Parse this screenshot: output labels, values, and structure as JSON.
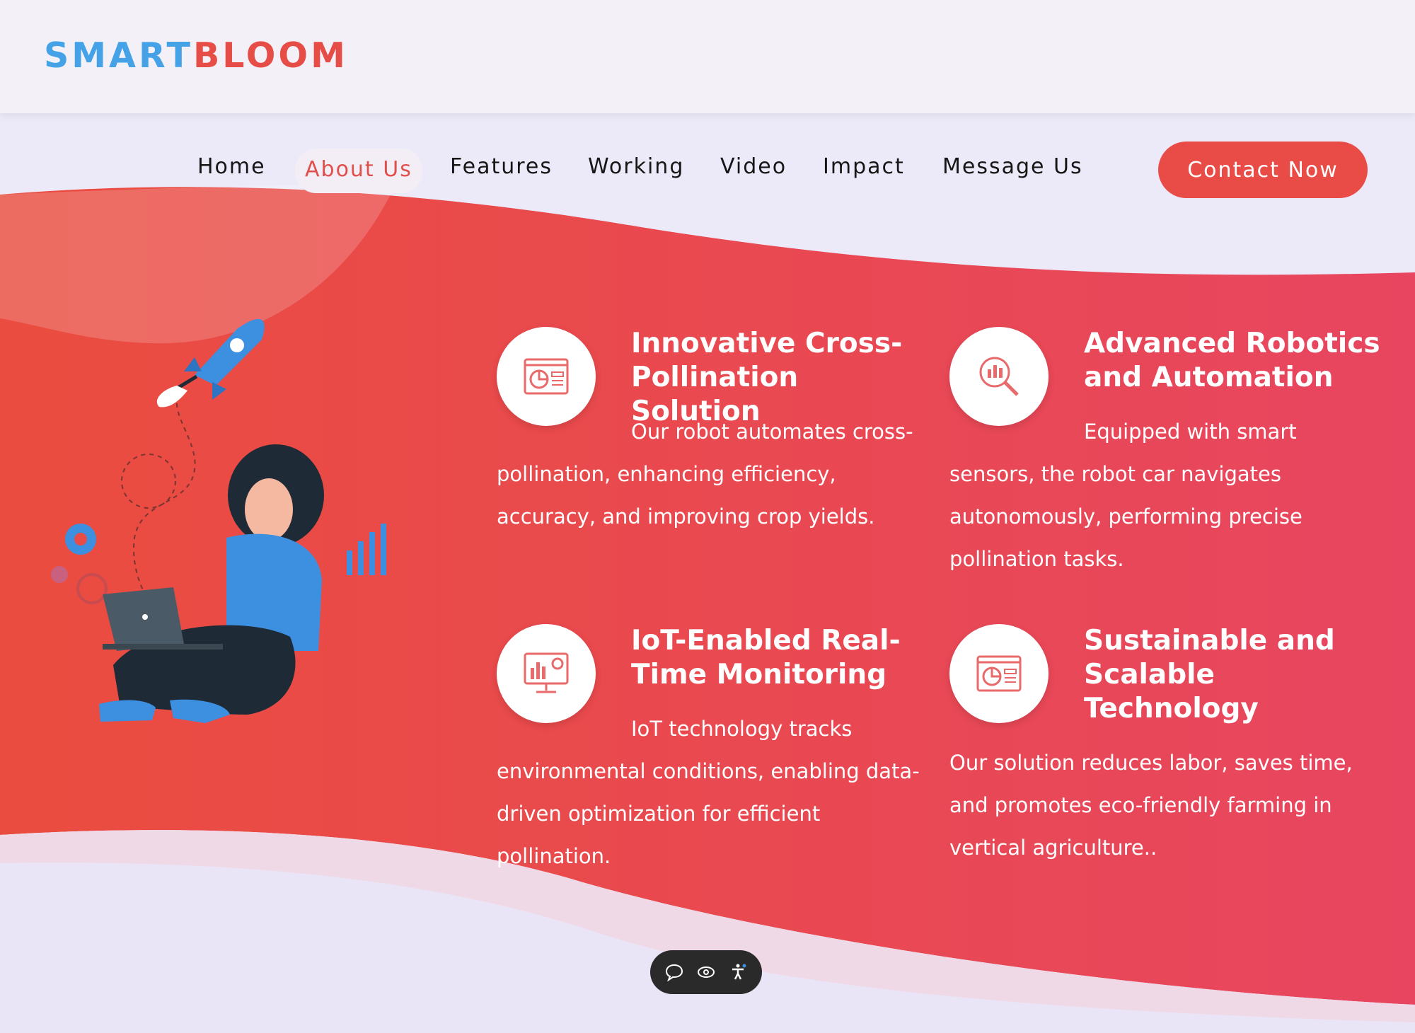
{
  "brand": {
    "part1": "SMART",
    "part2": "BLOOM"
  },
  "nav": {
    "items": [
      {
        "label": "Home"
      },
      {
        "label": "About Us"
      },
      {
        "label": "Features"
      },
      {
        "label": "Working"
      },
      {
        "label": "Video"
      },
      {
        "label": "Impact"
      },
      {
        "label": "Message Us"
      }
    ],
    "active": "About Us",
    "contact_label": "Contact Now"
  },
  "features": [
    {
      "title": "Innovative Cross-Pollination Solution",
      "text": "Our robot automates cross-pollination, enhancing efficiency, accuracy, and improving crop yields.",
      "icon": "pie-chart-document-icon"
    },
    {
      "title": "Advanced Robotics and Automation",
      "text": "Equipped with smart sensors, the robot car navigates autonomously, performing precise pollination tasks.",
      "icon": "magnifier-chart-icon"
    },
    {
      "title": "IoT-Enabled Real-Time Monitoring",
      "text": "IoT technology tracks environmental conditions, enabling data-driven optimization for efficient pollination.",
      "icon": "monitor-chart-icon"
    },
    {
      "title": "Sustainable and Scalable Technology",
      "text": "Our solution reduces labor, saves time, and promotes eco-friendly farming in vertical agriculture..",
      "icon": "pie-chart-document-icon"
    }
  ],
  "accessibility_toolbar": {
    "icons": [
      "chat-bubble-icon",
      "eye-icon",
      "accessibility-person-icon"
    ]
  },
  "colors": {
    "brand_blue": "#45a2e6",
    "brand_red": "#e64d47",
    "accent_red": "#e94c46",
    "background": "#eceaf9"
  }
}
